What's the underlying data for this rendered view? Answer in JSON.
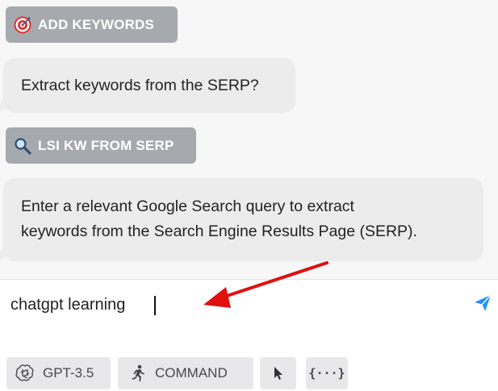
{
  "chat": {
    "add_keywords_chip": {
      "label": "ADD KEYWORDS",
      "icon": "target-icon"
    },
    "bubble_1": {
      "text": "Extract keywords from the SERP?"
    },
    "lsi_chip": {
      "label": "LSI KW FROM SERP",
      "icon": "magnifier-icon"
    },
    "bubble_2": {
      "line_1": "Enter a relevant Google Search query to extract",
      "line_2": "keywords from the Search Engine Results Page (SERP)."
    }
  },
  "input": {
    "value": "chatgpt learning",
    "send_icon": "send-icon"
  },
  "annotation": {
    "arrow_color": "#e01010"
  },
  "toolbar": {
    "model_label": "GPT-3.5",
    "command_label": "COMMAND",
    "cursor_icon": "cursor-icon",
    "json_label": "{···}"
  },
  "colors": {
    "chip_bg": "#a6a9ae",
    "bubble_bg": "#ececec",
    "send_accent": "#1e90ff",
    "toolbar_bg": "#e8e8ea"
  }
}
